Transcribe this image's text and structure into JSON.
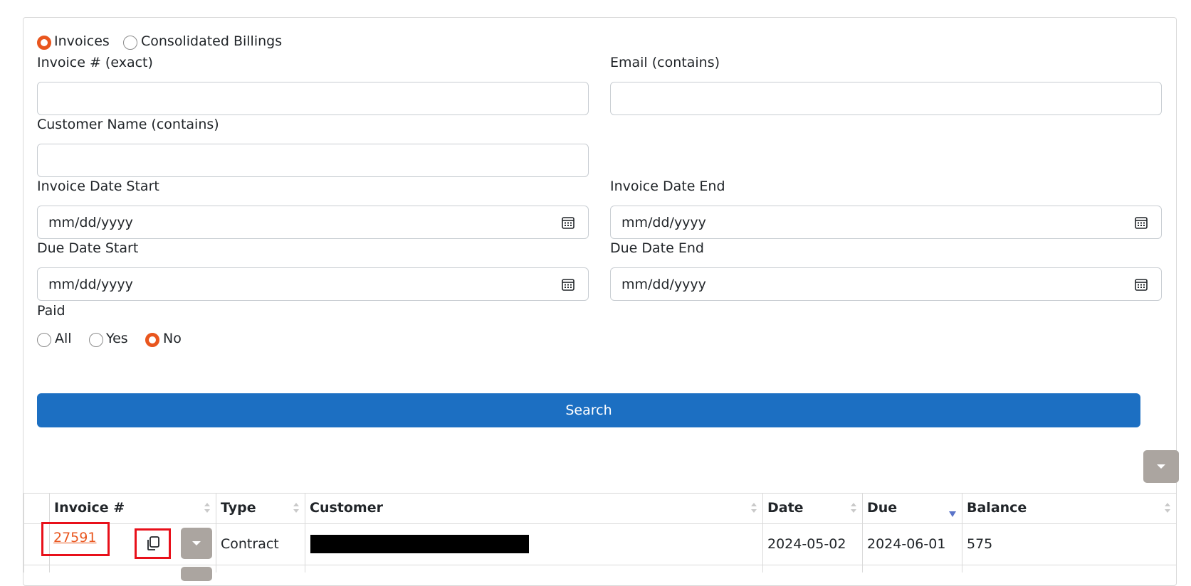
{
  "filters": {
    "type_options": [
      {
        "label": "Invoices",
        "selected": true
      },
      {
        "label": "Consolidated Billings",
        "selected": false
      }
    ],
    "invoice_number_label": "Invoice # (exact)",
    "email_label": "Email (contains)",
    "customer_name_label": "Customer Name (contains)",
    "invoice_date_start_label": "Invoice Date Start",
    "invoice_date_start_value": "mm/dd/yyyy",
    "invoice_date_end_label": "Invoice Date End",
    "invoice_date_end_value": "mm/dd/yyyy",
    "due_date_start_label": "Due Date Start",
    "due_date_start_value": "mm/dd/yyyy",
    "due_date_end_label": "Due Date End",
    "due_date_end_value": "mm/dd/yyyy",
    "paid_label": "Paid",
    "paid_options": [
      {
        "label": "All",
        "selected": false
      },
      {
        "label": "Yes",
        "selected": false
      },
      {
        "label": "No",
        "selected": true
      }
    ],
    "search_label": "Search"
  },
  "table": {
    "columns": [
      "Invoice #",
      "Type",
      "Customer",
      "Date",
      "Due",
      "Balance"
    ],
    "sorted_column": "Due",
    "rows": [
      {
        "invoice": "27591",
        "type": "Contract",
        "customer": "",
        "date": "2024-05-02",
        "due": "2024-06-01",
        "balance": "575"
      }
    ]
  },
  "colors": {
    "accent": "#e9561e",
    "primary_button": "#1c6fc2",
    "highlight": "#e8101a"
  },
  "icons": {
    "calendar": "calendar-icon",
    "copy": "copy-icon",
    "caret": "caret-down-icon",
    "sort": "sort-icon"
  }
}
